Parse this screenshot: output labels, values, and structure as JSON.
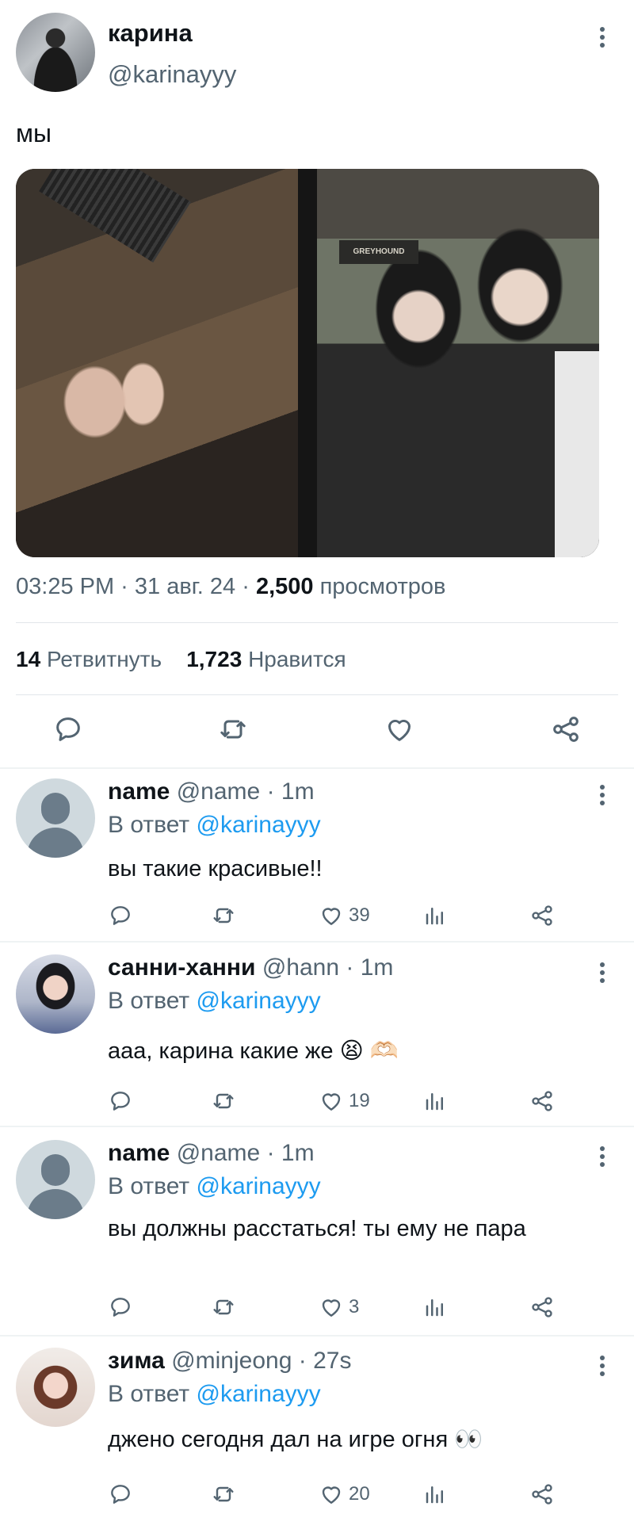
{
  "main_tweet": {
    "author_name": "карина",
    "author_handle": "@karinayyy",
    "text": "мы",
    "meta_time_date": "03:25 PM · 31 авг. 24 · ",
    "views_count": "2,500",
    "views_label": " просмотров",
    "retweets_count": "14",
    "retweets_label": "Ретвитнуть",
    "likes_count": "1,723",
    "likes_label": "Нравится",
    "photo_sign_text": "GREYHOUND"
  },
  "replies": [
    {
      "name": "name",
      "handle": "@name",
      "time": "1m",
      "reply_prefix": "В ответ ",
      "reply_to": "@karinayyy",
      "text": "вы такие красивые!!",
      "likes": "39"
    },
    {
      "name": "санни-ханни",
      "handle": "@hann",
      "time": "1m",
      "reply_prefix": "В ответ ",
      "reply_to": "@karinayyy",
      "text": "ааа, карина какие же 😫 🫶🏻",
      "likes": "19"
    },
    {
      "name": "name",
      "handle": "@name",
      "time": "1m",
      "reply_prefix": "В ответ ",
      "reply_to": "@karinayyy",
      "text": "вы должны расстаться! ты ему не пара",
      "likes": "3"
    },
    {
      "name": "зима",
      "handle": "@minjeong",
      "time": "27s",
      "reply_prefix": "В ответ ",
      "reply_to": "@karinayyy",
      "text": "джено сегодня дал на игре огня 👀",
      "likes": "20"
    }
  ],
  "colors": {
    "text_primary": "#0f1419",
    "text_secondary": "#536471",
    "link": "#1d9bf0",
    "divider": "#eff3f4"
  },
  "icons": [
    "more-icon",
    "reply-icon",
    "retweet-icon",
    "like-icon",
    "share-icon",
    "views-icon"
  ]
}
